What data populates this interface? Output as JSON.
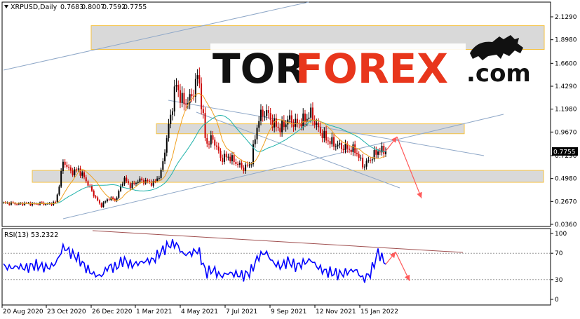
{
  "header": {
    "symbol": "XRPUSD,Daily",
    "open": "0.7683",
    "high": "0.8007",
    "low": "0.7592",
    "close": "0.7755"
  },
  "current_price_label": "0.7755",
  "logo": {
    "tor": "TOR",
    "forex": "FOREX",
    "domain": ".com"
  },
  "rsi_header": "RSI(13) 53.2322",
  "colors": {
    "bull_candle": "#000000",
    "bear_candle": "#cc0000",
    "ma_fast": "#f0a020",
    "ma_slow": "#20b2aa",
    "rsi_line": "#0000ff",
    "rsi_trend": "#a05050",
    "channel": "#8fa8c8",
    "zone_fill": "#d9d9d9",
    "zone_border": "#f5c242",
    "forecast_arrow": "#ff5a5a",
    "logo_red": "#e8361c"
  },
  "chart_data": [
    {
      "type": "candlestick",
      "title": "XRPUSD,Daily",
      "price_axis_ticks": [
        "2.1290",
        "1.8980",
        "1.6600",
        "1.4290",
        "1.1980",
        "0.9670",
        "0.7290",
        "0.4980",
        "0.2670",
        "0.0360"
      ],
      "date_axis_ticks": [
        "20 Aug 2020",
        "23 Oct 2020",
        "26 Dec 2020",
        "1 Mar 2021",
        "4 May 2021",
        "7 Jul 2021",
        "9 Sep 2021",
        "12 Nov 2021",
        "15 Jan 2022"
      ],
      "ylim": [
        0.036,
        2.129
      ],
      "close_series_weekly": [
        0.25,
        0.25,
        0.24,
        0.25,
        0.24,
        0.25,
        0.24,
        0.26,
        0.68,
        0.56,
        0.59,
        0.48,
        0.34,
        0.22,
        0.3,
        0.28,
        0.5,
        0.42,
        0.48,
        0.47,
        0.45,
        0.55,
        1.0,
        1.45,
        1.25,
        1.3,
        1.55,
        0.85,
        0.9,
        0.7,
        0.72,
        0.66,
        0.6,
        0.65,
        1.1,
        1.18,
        1.05,
        1.0,
        1.1,
        1.05,
        1.08,
        1.15,
        1.0,
        0.9,
        0.85,
        0.82,
        0.8,
        0.78,
        0.62,
        0.7,
        0.78,
        0.7755
      ],
      "moving_averages": [
        "orange fast MA",
        "teal slow MA"
      ],
      "support_resistance_zones": [
        [
          1.8,
          2.04
        ],
        [
          0.95,
          1.05
        ],
        [
          0.46,
          0.58
        ]
      ],
      "forecast": {
        "up_target": 0.92,
        "down_target": 0.3
      }
    },
    {
      "type": "line",
      "title": "RSI(13) 53.2322",
      "ylim": [
        0,
        100
      ],
      "levels": [
        70,
        30
      ],
      "tick_labels": [
        "100",
        "70",
        "30",
        "0"
      ],
      "values_weekly": [
        50,
        48,
        50,
        47,
        52,
        50,
        48,
        55,
        80,
        70,
        62,
        48,
        38,
        35,
        50,
        48,
        60,
        52,
        55,
        58,
        60,
        72,
        82,
        85,
        68,
        70,
        75,
        40,
        45,
        35,
        40,
        38,
        36,
        42,
        65,
        72,
        55,
        50,
        58,
        50,
        55,
        60,
        48,
        42,
        40,
        38,
        42,
        45,
        30,
        40,
        72,
        53.2322
      ],
      "forecast": {
        "up_target": 72,
        "down_target": 28
      }
    }
  ]
}
